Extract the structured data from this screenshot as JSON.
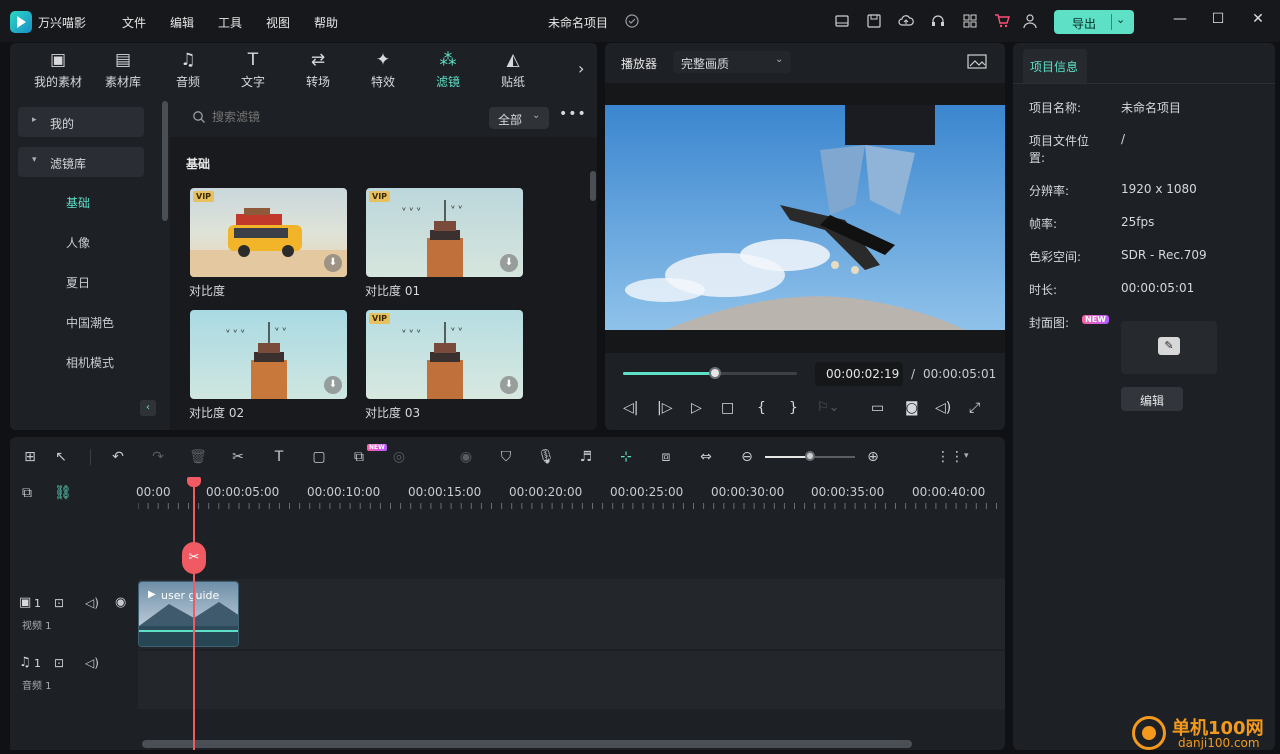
{
  "app": {
    "title": "万兴喵影",
    "project_name": "未命名项目"
  },
  "menu": [
    "文件",
    "编辑",
    "工具",
    "视图",
    "帮助"
  ],
  "export_label": "导出",
  "media_tabs": [
    {
      "label": "我的素材",
      "icon": "image-icon"
    },
    {
      "label": "素材库",
      "icon": "cloud-image-icon"
    },
    {
      "label": "音频",
      "icon": "music-note-icon"
    },
    {
      "label": "文字",
      "icon": "text-t-icon"
    },
    {
      "label": "转场",
      "icon": "transition-icon"
    },
    {
      "label": "特效",
      "icon": "sparkle-icon"
    },
    {
      "label": "滤镜",
      "icon": "filter-circles-icon"
    },
    {
      "label": "贴纸",
      "icon": "sticker-icon"
    }
  ],
  "sidebar": {
    "mine": "我的",
    "library": "滤镜库",
    "subitems": [
      "基础",
      "人像",
      "夏日",
      "中国潮色",
      "相机模式"
    ]
  },
  "search": {
    "placeholder": "搜索滤镜",
    "scope": "全部"
  },
  "section_title": "基础",
  "filters": [
    {
      "label": "对比度",
      "vip": "VIP"
    },
    {
      "label": "对比度 01",
      "vip": "VIP"
    },
    {
      "label": "对比度 02",
      "vip": ""
    },
    {
      "label": "对比度 03",
      "vip": "VIP"
    }
  ],
  "player": {
    "label": "播放器",
    "quality": "完整画质",
    "current_time": "00:00:02:19",
    "separator": "/",
    "total_time": "00:00:05:01",
    "progress": 0.53,
    "controls": [
      "{",
      "}"
    ]
  },
  "info": {
    "tab": "项目信息",
    "rows": [
      {
        "key": "项目名称:",
        "value": "未命名项目"
      },
      {
        "key": "项目文件位",
        "key2": "置:",
        "value": "/"
      },
      {
        "key": "分辨率:",
        "value": "1920 x 1080"
      },
      {
        "key": "帧率:",
        "value": "25fps"
      },
      {
        "key": "色彩空间:",
        "value": "SDR - Rec.709"
      },
      {
        "key": "时长:",
        "value": "00:00:05:01"
      }
    ],
    "cover_label": "封面图:",
    "new_badge": "NEW",
    "edit_label": "编辑"
  },
  "toolbar": {
    "new_badge": "NEW",
    "zoom_level": 0.5
  },
  "ruler": [
    "00:00",
    "00:00:05:00",
    "00:00:10:00",
    "00:00:15:00",
    "00:00:20:00",
    "00:00:25:00",
    "00:00:30:00",
    "00:00:35:00",
    "00:00:40:00"
  ],
  "tracks": {
    "video": {
      "num": "1",
      "label": "视频 1"
    },
    "audio": {
      "num": "1",
      "label": "音频 1"
    },
    "clip_label": "user guide"
  },
  "watermark": {
    "site": "单机100网",
    "url": "danji100.com"
  }
}
